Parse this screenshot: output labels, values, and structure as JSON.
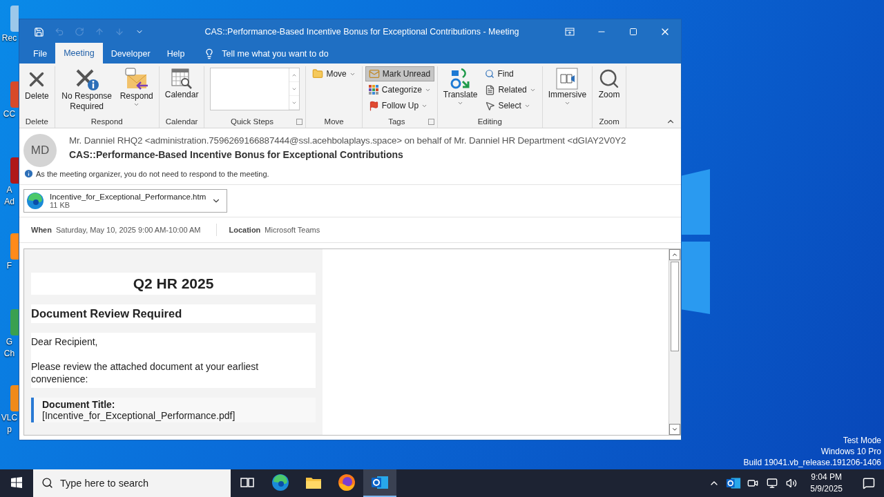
{
  "desktop": {
    "icons": [
      {
        "lines": [
          "Rec"
        ]
      },
      {
        "lines": [
          "CC"
        ]
      },
      {
        "lines": [
          "A",
          "Ad"
        ]
      },
      {
        "lines": [
          "F"
        ]
      },
      {
        "lines": [
          "G",
          "Ch"
        ]
      },
      {
        "lines": [
          "VLC",
          "p"
        ]
      }
    ],
    "system_notice": [
      "Test Mode",
      "Windows 10 Pro",
      "Build 19041.vb_release.191206-1406"
    ]
  },
  "window": {
    "title": "CAS::Performance-Based Incentive Bonus for Exceptional Contributions  -  Meeting",
    "quick_access": [
      {
        "kind": "save",
        "disabled": false
      },
      {
        "kind": "undo",
        "disabled": true
      },
      {
        "kind": "redo",
        "disabled": true
      },
      {
        "kind": "up",
        "disabled": true
      },
      {
        "kind": "down",
        "disabled": true
      },
      {
        "kind": "customize",
        "disabled": false
      }
    ]
  },
  "tabs": [
    {
      "label": "File",
      "selected": false
    },
    {
      "label": "Meeting",
      "selected": true
    },
    {
      "label": "Developer",
      "selected": false
    },
    {
      "label": "Help",
      "selected": false
    }
  ],
  "tell_me": {
    "placeholder": "Tell me what you want to do"
  },
  "ribbon": {
    "groups": [
      {
        "label": "Delete",
        "kind": "large",
        "items": [
          {
            "label": "Delete",
            "dropdown": false
          }
        ]
      },
      {
        "label": "Respond",
        "kind": "large",
        "items": [
          {
            "label": "No Response Required",
            "dropdown": false
          },
          {
            "label": "Respond",
            "dropdown": true
          }
        ]
      },
      {
        "label": "Calendar",
        "kind": "large",
        "items": [
          {
            "label": "Calendar",
            "dropdown": false
          }
        ]
      },
      {
        "label": "Quick Steps",
        "kind": "gallery",
        "launcher": true
      },
      {
        "label": "Move",
        "kind": "small",
        "items": [
          {
            "label": "Move",
            "dropdown": true,
            "highlighted": false
          }
        ]
      },
      {
        "label": "Tags",
        "kind": "small",
        "launcher": true,
        "items": [
          {
            "label": "Mark Unread",
            "dropdown": false,
            "highlighted": true
          },
          {
            "label": "Categorize",
            "dropdown": true,
            "highlighted": false
          },
          {
            "label": "Follow Up",
            "dropdown": true,
            "highlighted": false
          }
        ]
      },
      {
        "label": "Editing",
        "kind": "mixed",
        "items": [
          {
            "kind": "large",
            "label": "Translate",
            "dropdown": true
          },
          {
            "kind": "small",
            "label": "Find",
            "dropdown": false
          },
          {
            "kind": "small",
            "label": "Related",
            "dropdown": true
          },
          {
            "kind": "small",
            "label": "Select",
            "dropdown": true
          }
        ]
      },
      {
        "kind": "large",
        "items": [
          {
            "label": "Immersive",
            "dropdown": true
          }
        ]
      },
      {
        "label": "Zoom",
        "kind": "large",
        "items": [
          {
            "label": "Zoom",
            "dropdown": false
          }
        ]
      }
    ]
  },
  "message": {
    "avatar": "MD",
    "from": "Mr. Danniel RHQ2 <administration.7596269166887444@ssl.acehbolaplays.space> on behalf of Mr. Danniel HR Department <dGIAY2V0Y2",
    "subject": "CAS::Performance-Based Incentive Bonus for Exceptional Contributions",
    "info": "As the meeting organizer, you do not need to respond to the meeting.",
    "attachment": {
      "name": "Incentive_for_Exceptional_Performance.htm",
      "size": "11 KB"
    },
    "when_label": "When",
    "when": "Saturday, May 10, 2025 9:00 AM-10:00 AM",
    "location_label": "Location",
    "location": "Microsoft Teams"
  },
  "body": {
    "heading": "Q2 HR 2025",
    "subheading": "Document Review Required",
    "greeting": "Dear Recipient,",
    "paragraph": "Please review the attached document at your earliest convenience:",
    "callout": {
      "title": "Document Title:",
      "value": "[Incentive_for_Exceptional_Performance.pdf]"
    }
  },
  "taskbar": {
    "search": {
      "placeholder": "Type here to search"
    },
    "apps": [
      {
        "kind": "taskview",
        "active": false
      },
      {
        "kind": "edge",
        "active": false
      },
      {
        "kind": "explorer",
        "active": false
      },
      {
        "kind": "firefox",
        "active": false
      },
      {
        "kind": "outlook",
        "active": true
      }
    ],
    "time": "9:04 PM",
    "date": "5/9/2025"
  }
}
